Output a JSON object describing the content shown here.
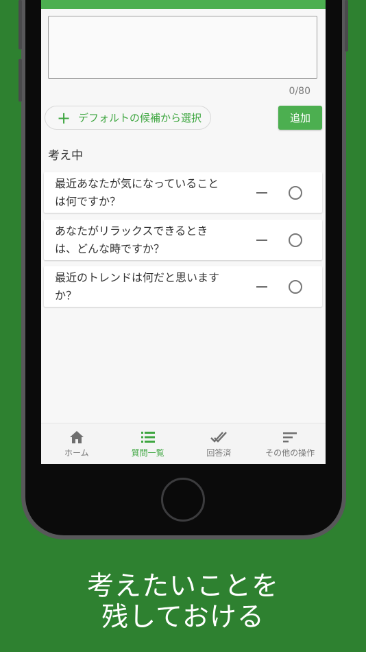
{
  "input": {
    "counter": "0/80"
  },
  "actions": {
    "default_label": "デフォルトの候補から選択",
    "add_label": "追加"
  },
  "section": {
    "title": "考え中"
  },
  "questions": [
    {
      "line1": "最近あなたが気になっていること",
      "line2": "は何ですか？"
    },
    {
      "line1": "あなたがリラックスできるとき",
      "line2": "は、どんな時ですか？"
    },
    {
      "line1": "最近のトレンドは何だと思います",
      "line2": "か？"
    }
  ],
  "nav": [
    {
      "label": "ホーム",
      "icon": "home-icon"
    },
    {
      "label": "質問一覧",
      "icon": "list-icon",
      "active": true
    },
    {
      "label": "回答済",
      "icon": "double-check-icon"
    },
    {
      "label": "その他の操作",
      "icon": "sort-icon"
    }
  ],
  "caption": {
    "line1": "考えたいことを",
    "line2": "残しておける"
  },
  "colors": {
    "accent": "#4caf50",
    "background": "#2e8130"
  }
}
